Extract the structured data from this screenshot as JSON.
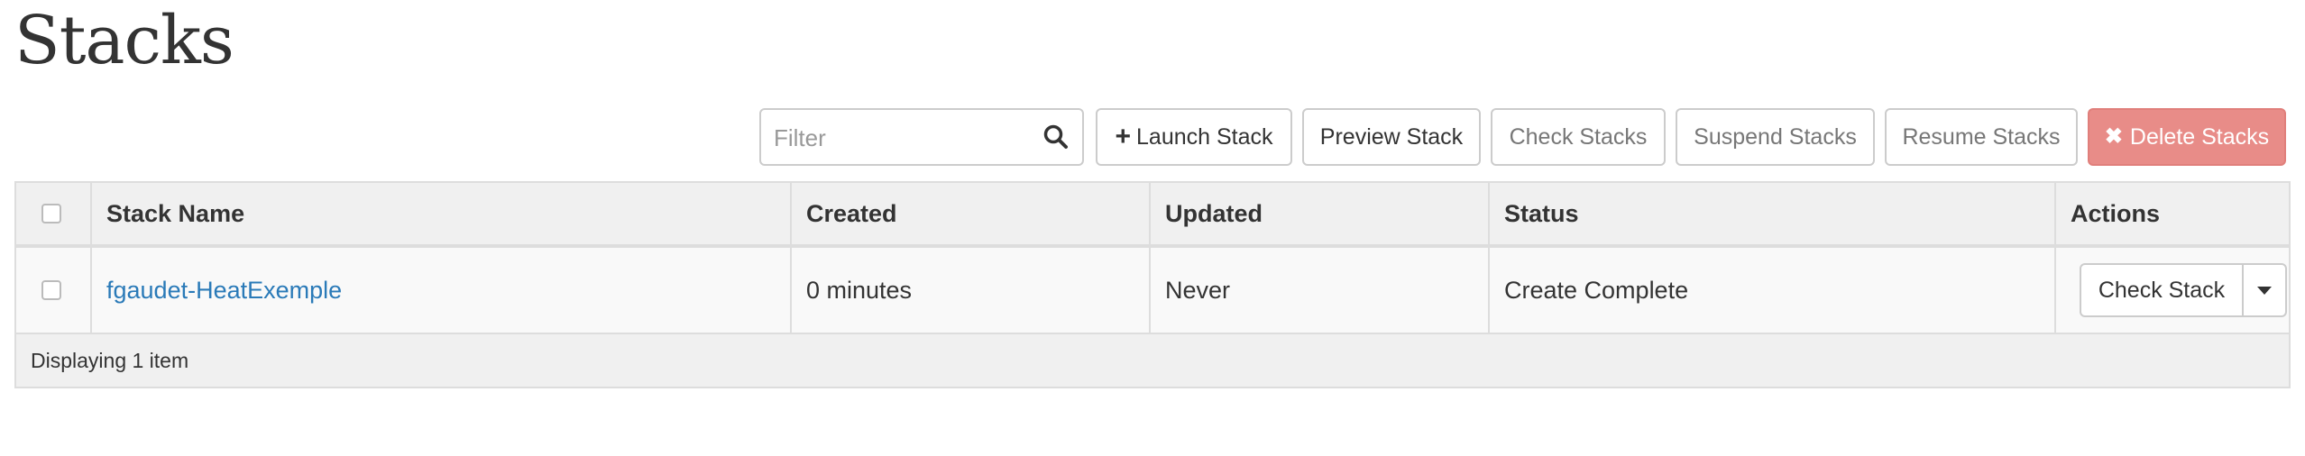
{
  "page": {
    "title": "Stacks"
  },
  "toolbar": {
    "filter_placeholder": "Filter",
    "filter_value": "",
    "launch_label": "Launch Stack",
    "preview_label": "Preview Stack",
    "check_label": "Check Stacks",
    "suspend_label": "Suspend Stacks",
    "resume_label": "Resume Stacks",
    "delete_label": "Delete Stacks"
  },
  "table": {
    "columns": [
      "Stack Name",
      "Created",
      "Updated",
      "Status",
      "Actions"
    ],
    "rows": [
      {
        "name": "fgaudet-HeatExemple",
        "created": "0 minutes",
        "updated": "Never",
        "status": "Create Complete",
        "action_label": "Check Stack"
      }
    ],
    "footer": "Displaying 1 item"
  },
  "icons": {
    "search": "search-icon",
    "plus": "plus-icon",
    "delete": "times-icon",
    "dropdown": "caret-down-icon"
  },
  "colors": {
    "link": "#2a7ab8",
    "danger": "#e88c88",
    "header_bg": "#f0f0f0",
    "border": "#dddddd"
  }
}
